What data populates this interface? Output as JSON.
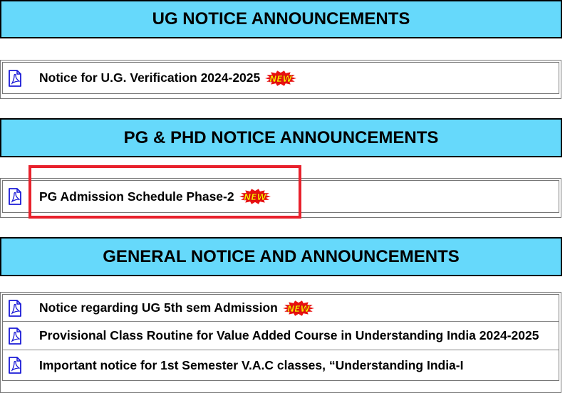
{
  "sections": [
    {
      "title": "UG NOTICE ANNOUNCEMENTS",
      "items": [
        {
          "label": "Notice for U.G. Verification 2024-2025",
          "is_new": true,
          "icon": "pdf-icon"
        }
      ]
    },
    {
      "title": "PG & PHD NOTICE ANNOUNCEMENTS",
      "items": [
        {
          "label": "PG Admission Schedule Phase-2",
          "is_new": true,
          "icon": "pdf-icon"
        }
      ]
    },
    {
      "title": "GENERAL NOTICE AND ANNOUNCEMENTS",
      "items": [
        {
          "label": "Notice regarding UG 5th sem Admission",
          "is_new": true,
          "icon": "pdf-icon"
        },
        {
          "label": "Provisional Class Routine for Value Added Course in Understanding India 2024-2025",
          "is_new": false,
          "icon": "pdf-icon"
        },
        {
          "label": "Important notice for 1st Semester V.A.C classes, “Understanding India-I",
          "is_new": false,
          "icon": "pdf-icon"
        }
      ]
    }
  ],
  "new_badge_text": "NEW",
  "colors": {
    "header_bg": "#66d9fb",
    "highlight": "#e8212c",
    "pdf_icon": "#1a1ad6",
    "badge_burst": "#e81010",
    "badge_text": "#ffe600"
  }
}
